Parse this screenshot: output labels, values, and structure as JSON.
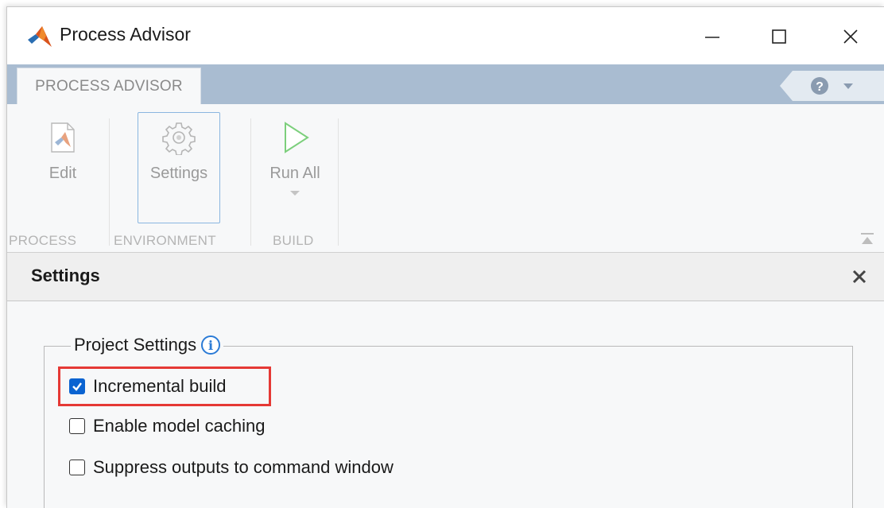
{
  "window": {
    "title": "Process Advisor"
  },
  "toolstrip": {
    "tab_label": "PROCESS ADVISOR",
    "buttons": {
      "edit": "Edit",
      "settings": "Settings",
      "run_all": "Run All"
    },
    "groups": {
      "process": "PROCESS",
      "environment": "ENVIRONMENT",
      "build": "BUILD"
    },
    "help_glyph": "?"
  },
  "settings_panel": {
    "title": "Settings",
    "project_settings_label": "Project Settings",
    "info_glyph": "i",
    "options": [
      {
        "label": "Incremental build",
        "checked": true
      },
      {
        "label": "Enable model caching",
        "checked": false
      },
      {
        "label": "Suppress outputs to command window",
        "checked": false
      }
    ]
  },
  "colors": {
    "tabstrip": "#a9bcd1",
    "highlight": "#e53935",
    "checkbox_checked": "#0a63d1",
    "run_icon": "#7ccf7c"
  },
  "icons": [
    "matlab-logo-icon",
    "minimize-icon",
    "maximize-icon",
    "close-icon",
    "help-icon",
    "edit-icon",
    "gear-icon",
    "play-icon",
    "collapse-ribbon-icon",
    "info-icon"
  ]
}
